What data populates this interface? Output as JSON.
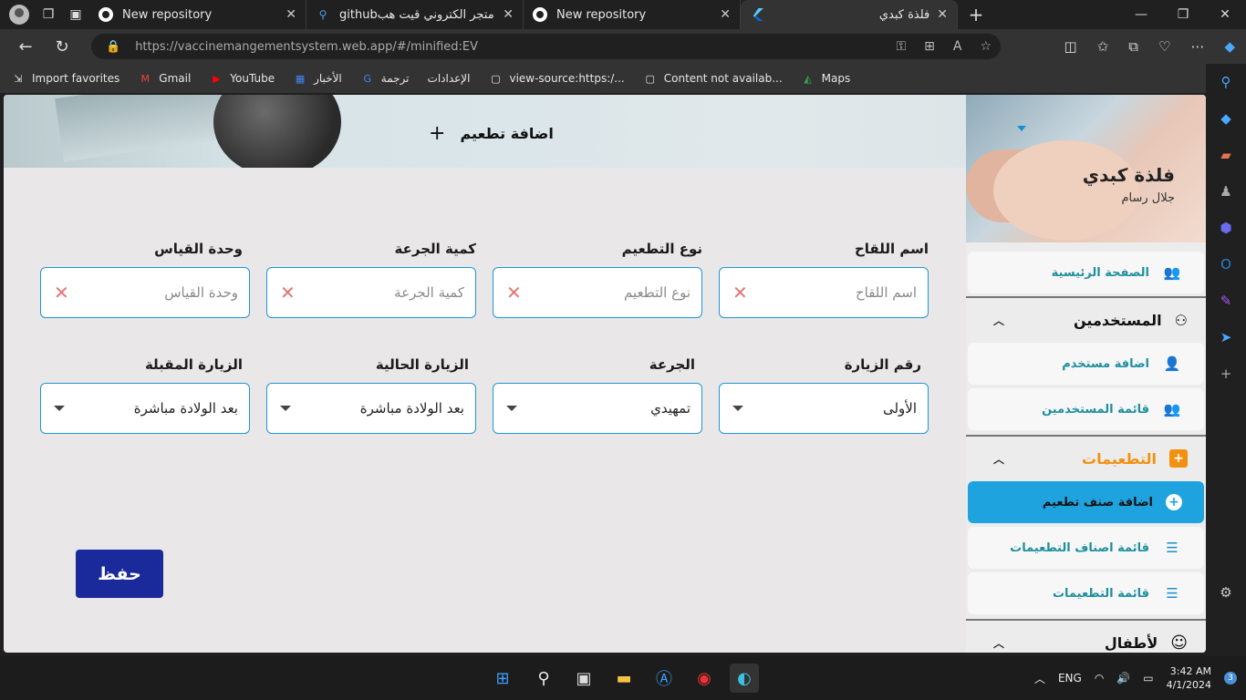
{
  "browser": {
    "tabs": [
      {
        "title": "New repository",
        "active": false
      },
      {
        "title": "githubتطبيق متجر الكتروني قيت هب",
        "active": false
      },
      {
        "title": "New repository",
        "active": false
      },
      {
        "title": "فلذة كبدي",
        "active": true
      }
    ],
    "url": "https://vaccinemangementsystem.web.app/#/minified:EV",
    "bookmarks": [
      "Import favorites",
      "Gmail",
      "YouTube",
      "الأخبار",
      "ترجمة",
      "الإعدادات",
      "view-source:https:/...",
      "Content not availab...",
      "Maps"
    ]
  },
  "page": {
    "header_title": "اضافة تطعيم",
    "fields": {
      "vaccine_name": {
        "label": "اسم اللقاح",
        "placeholder": "اسم اللقاح"
      },
      "vaccination_type": {
        "label": "نوع التطعيم",
        "placeholder": "نوع التطعيم"
      },
      "dose_amount": {
        "label": "كمية الجرعة",
        "placeholder": "كمية الجرعة"
      },
      "unit": {
        "label": "وحدة القياس",
        "placeholder": "وحدة القياس"
      },
      "visit_number": {
        "label": "رقم الزيارة",
        "value": "الأولى"
      },
      "dose": {
        "label": "الجرعة",
        "value": "تمهيدي"
      },
      "current_visit": {
        "label": "الزيارة الحالية",
        "value": "بعد الولادة مباشرة"
      },
      "next_visit": {
        "label": "الزيارة المقبلة",
        "value": "بعد الولادة مباشرة"
      }
    },
    "save_label": "حفظ"
  },
  "sidebar": {
    "app_name": "فلذة كبدي",
    "user_name": "جلال رسام",
    "home": "الصفحة الرئيسية",
    "users_section": "المستخدمين",
    "add_user": "اضافة مستخدم",
    "users_list": "قائمة المستخدمين",
    "vaccinations_section": "التطعيمات",
    "add_vaccine_type": "اضافة صنف تطعيم",
    "vaccine_types_list": "قائمة اصناف التطعيمات",
    "vaccinations_list": "قائمة التطعيمات",
    "children_section": "لأطفال"
  },
  "taskbar": {
    "lang": "ENG",
    "time": "3:42 AM",
    "date": "4/1/2024",
    "notifications": "3"
  },
  "colors": {
    "accent": "#1ea3df",
    "save": "#1a2a9a",
    "vaccinations": "#f29111",
    "field_border": "#2196d3"
  }
}
